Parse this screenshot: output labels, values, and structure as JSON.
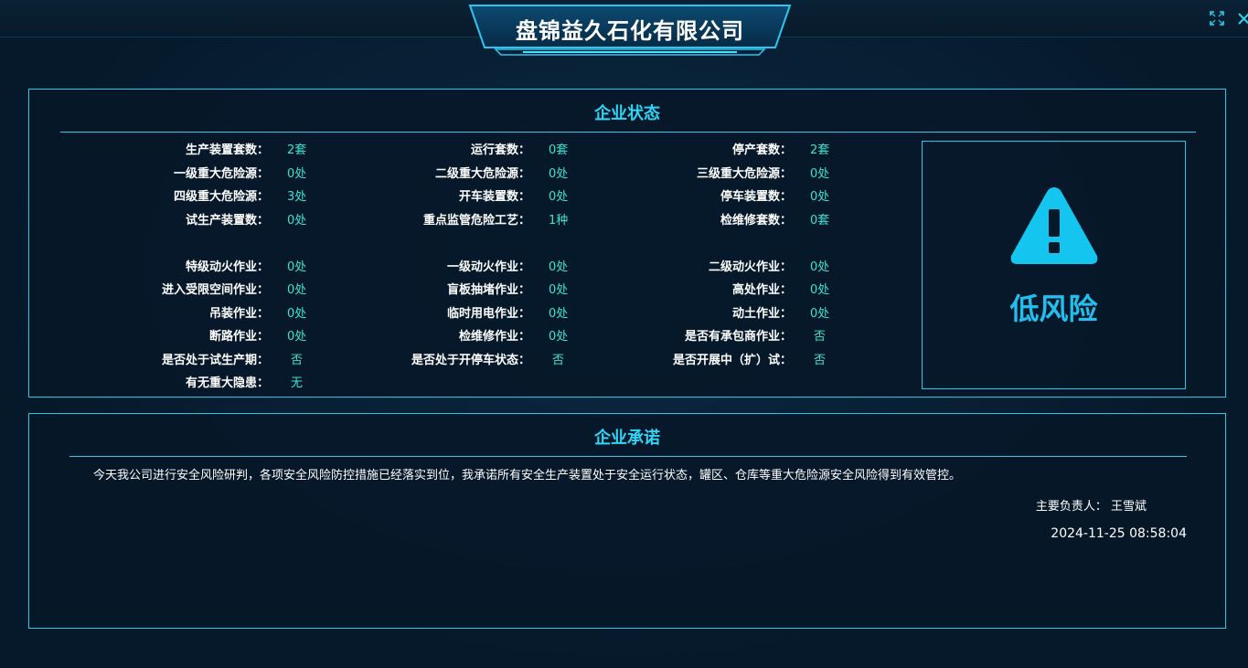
{
  "header": {
    "company_name": "盘锦益久石化有限公司"
  },
  "status_panel": {
    "title": "企业状态",
    "columns": [
      [
        {
          "label": "生产装置套数：",
          "value": "2套"
        },
        {
          "label": "一级重大危险源：",
          "value": "0处"
        },
        {
          "label": "四级重大危险源：",
          "value": "3处"
        },
        {
          "label": "试生产装置数：",
          "value": "0处"
        },
        {
          "label": "特级动火作业：",
          "value": "0处"
        },
        {
          "label": "进入受限空间作业：",
          "value": "0处"
        },
        {
          "label": "吊装作业：",
          "value": "0处"
        },
        {
          "label": "断路作业：",
          "value": "0处"
        },
        {
          "label": "是否处于试生产期：",
          "value": "否"
        },
        {
          "label": "有无重大隐患：",
          "value": "无"
        }
      ],
      [
        {
          "label": "运行套数：",
          "value": "0套"
        },
        {
          "label": "二级重大危险源：",
          "value": "0处"
        },
        {
          "label": "开车装置数：",
          "value": "0处"
        },
        {
          "label": "重点监管危险工艺：",
          "value": "1种"
        },
        {
          "label": "一级动火作业：",
          "value": "0处"
        },
        {
          "label": "盲板抽堵作业：",
          "value": "0处"
        },
        {
          "label": "临时用电作业：",
          "value": "0处"
        },
        {
          "label": "检维修作业：",
          "value": "0处"
        },
        {
          "label": "是否处于开停车状态：",
          "value": "否"
        }
      ],
      [
        {
          "label": "停产套数：",
          "value": "2套"
        },
        {
          "label": "三级重大危险源：",
          "value": "0处"
        },
        {
          "label": "停车装置数：",
          "value": "0处"
        },
        {
          "label": "检维修套数：",
          "value": "0套"
        },
        {
          "label": "二级动火作业：",
          "value": "0处"
        },
        {
          "label": "高处作业：",
          "value": "0处"
        },
        {
          "label": "动土作业：",
          "value": "0处"
        },
        {
          "label": "是否有承包商作业：",
          "value": "否"
        },
        {
          "label": "是否开展中（扩）试：",
          "value": "否"
        }
      ]
    ],
    "risk_level": "低风险"
  },
  "commitment_panel": {
    "title": "企业承诺",
    "text": "今天我公司进行安全风险研判，各项安全风险防控措施已经落实到位，我承诺所有安全生产装置处于安全运行状态，罐区、仓库等重大危险源安全风险得到有效管控。",
    "owner_label": "主要负责人：",
    "owner_name": "王雪斌",
    "datetime": "2024-11-25 08:58:04"
  },
  "colors": {
    "accent": "#2fd6f5",
    "value": "#3de3d2",
    "risk": "#22bfee",
    "background": "#06192b"
  }
}
